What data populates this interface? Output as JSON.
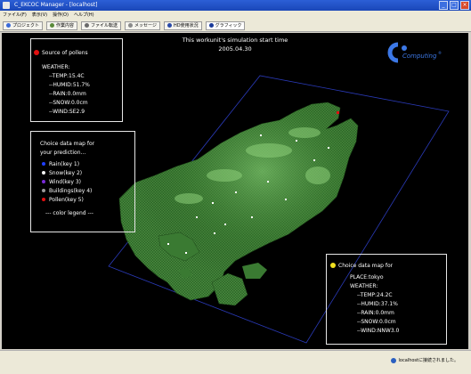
{
  "window": {
    "title": "C_EKCOC Manager - [localhost]"
  },
  "menu": [
    "ファイル(F)",
    "表示(V)",
    "操作(O)",
    "ヘルプ(H)"
  ],
  "tabs": [
    {
      "label": "プロジェクト",
      "icon": "project-icon",
      "color": "#3a6ad8"
    },
    {
      "label": "作業内容",
      "icon": "work-icon",
      "color": "#5a8a3a"
    },
    {
      "label": "ファイル転送",
      "icon": "transfer-icon",
      "color": "#6a6a6a"
    },
    {
      "label": "メッセージ",
      "icon": "message-icon",
      "color": "#8a8a8a"
    },
    {
      "label": "HD使用状況",
      "icon": "disk-icon",
      "color": "#2a4aa8"
    },
    {
      "label": "グラフィック",
      "icon": "graphics-icon",
      "color": "#1a3a9a"
    }
  ],
  "simulation": {
    "line1": "This workunit's simulation start time",
    "line2": "2005.04.30"
  },
  "logo": {
    "text": "Computing",
    "reg": "®"
  },
  "pollen_panel": {
    "title": "Source of pollens",
    "weather_label": "WEATHER:",
    "temp": "--TEMP:15.4C",
    "humid": "--HUMID:51.7%",
    "rain": "--RAIN:0.0mm",
    "snow": "--SNOW:0.0cm",
    "wind": "--WIND:SE2.9"
  },
  "legend_panel": {
    "line1": "Choice data map for",
    "line2": "your prediction...",
    "items": [
      {
        "label": "Rain(key 1)",
        "color": "#1f3fff"
      },
      {
        "label": "Snow(key 2)",
        "color": "#f2f2f2"
      },
      {
        "label": "Wind(key 3)",
        "color": "#7a2ad8"
      },
      {
        "label": "Buildings(key 4)",
        "color": "#9a9a9a"
      },
      {
        "label": "Pollen(key 5)",
        "color": "#e01010"
      }
    ],
    "footer": "--- color legend ---"
  },
  "place_panel": {
    "title": "Choice data map for",
    "place": "PLACE:tokyo",
    "weather_label": "WEATHER:",
    "temp": "--TEMP:24.2C",
    "humid": "--HUMID:37.1%",
    "rain": "--RAIN:0.0mm",
    "snow": "--SNOW:0.0cm",
    "wind": "--WIND:NNW3.0"
  },
  "status": {
    "text": "localhostに接続されました。"
  }
}
